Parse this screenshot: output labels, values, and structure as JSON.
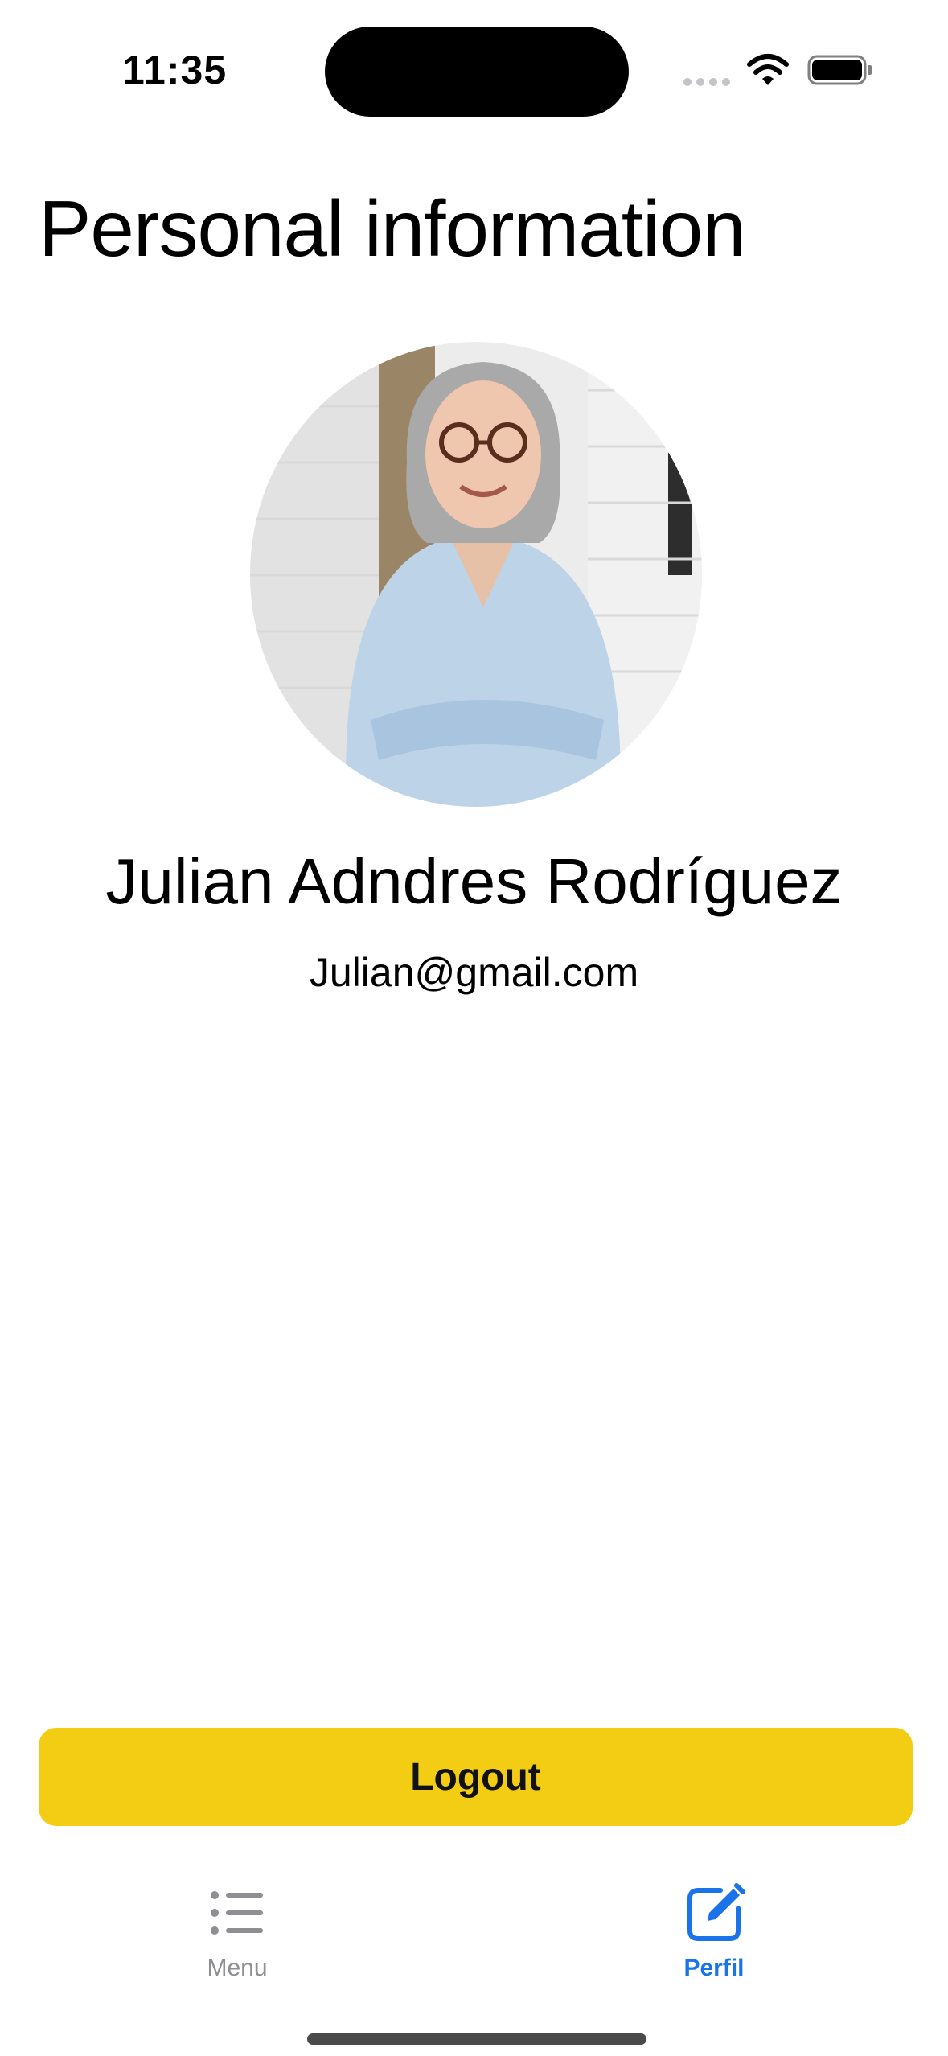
{
  "status_bar": {
    "time": "11:35"
  },
  "header": {
    "title": "Personal information"
  },
  "profile": {
    "name": "Julian Adndres Rodríguez",
    "email": "Julian@gmail.com"
  },
  "actions": {
    "logout_label": "Logout"
  },
  "tab_bar": {
    "items": [
      {
        "label": "Menu",
        "icon": "list-icon",
        "active": false
      },
      {
        "label": "Perfil",
        "icon": "edit-square-icon",
        "active": true
      }
    ]
  },
  "colors": {
    "logout_button": "#F2CD14",
    "active_tab": "#1a73e8",
    "inactive_tab": "#8e8e93"
  }
}
